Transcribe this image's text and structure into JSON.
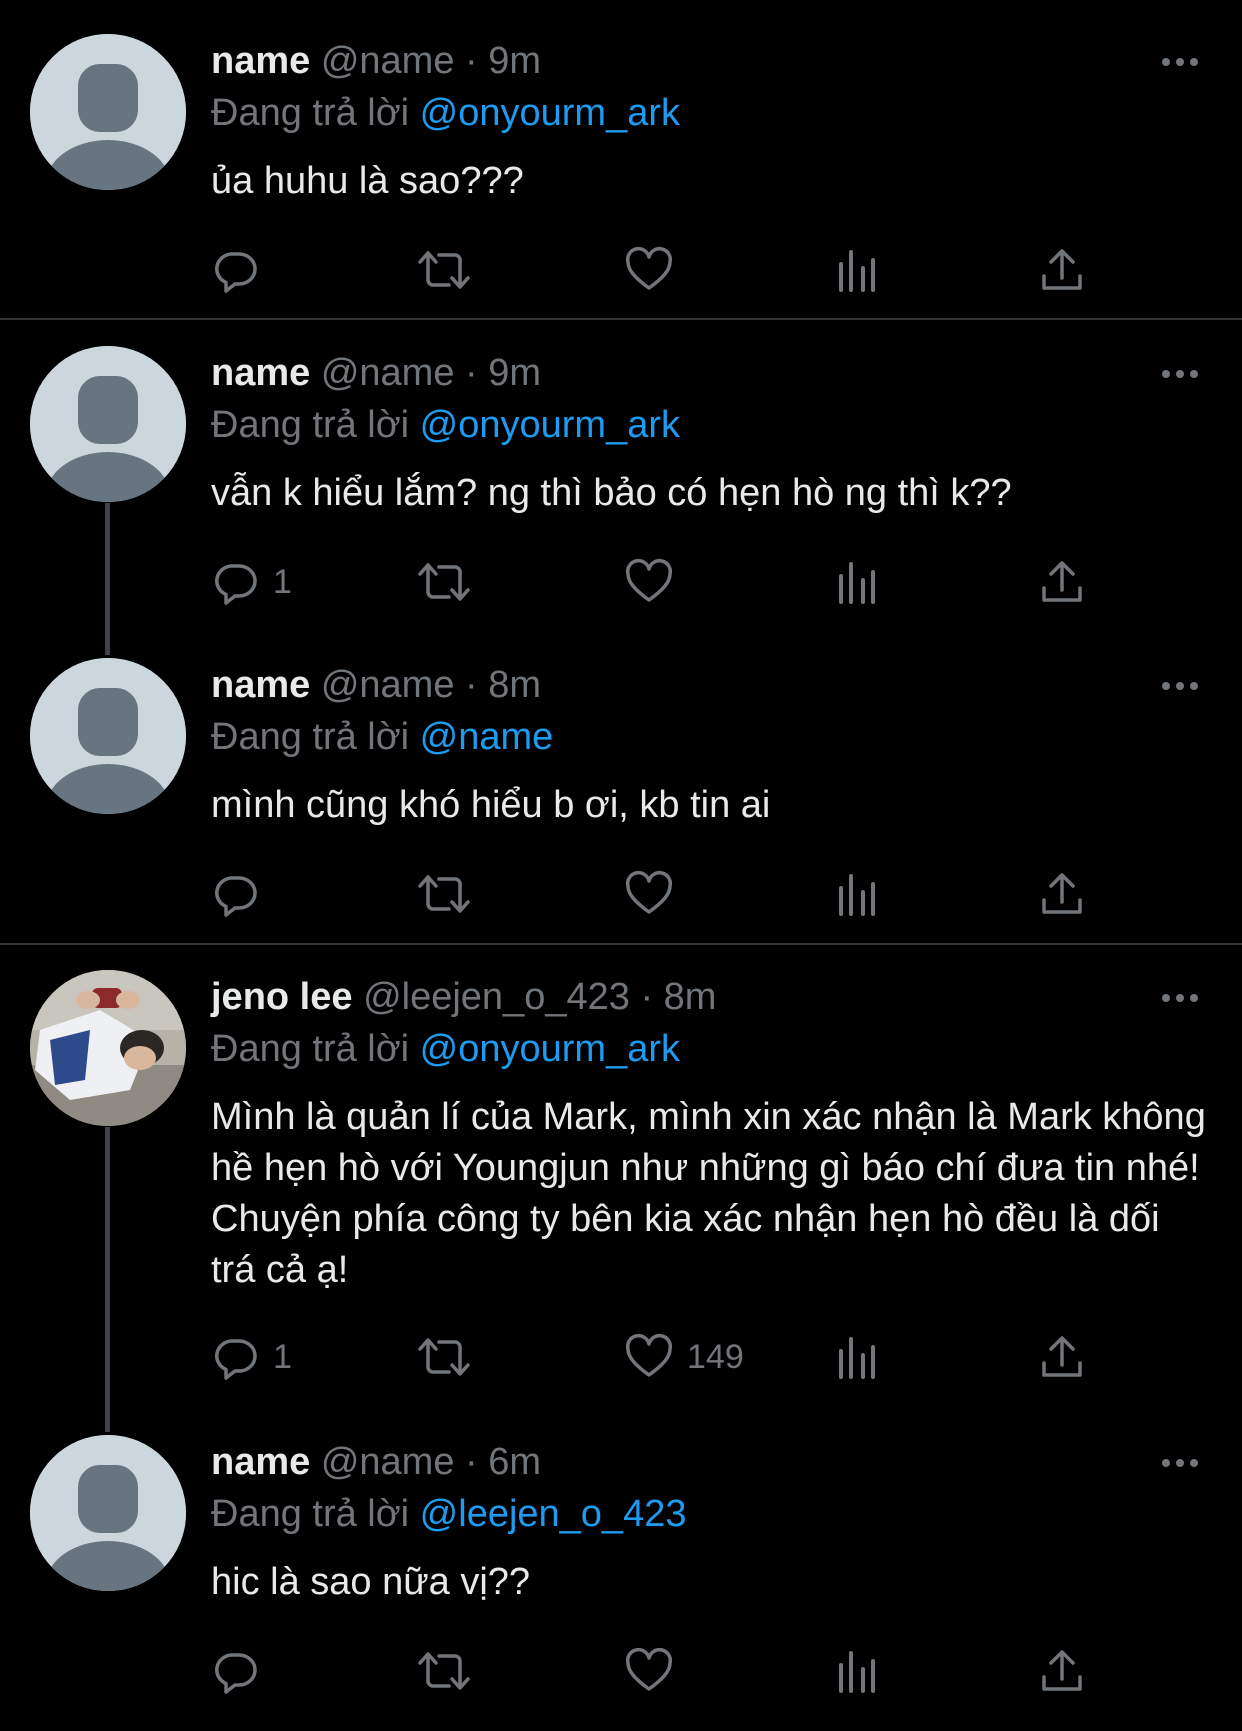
{
  "reply_prefix": "Đang trả lời",
  "colors": {
    "background": "#000000",
    "text": "#e7e9ea",
    "secondary": "#71767b",
    "accent": "#1d9bf0",
    "divider": "#2f3336"
  },
  "tweets": [
    {
      "name": "name",
      "handle": "@name",
      "dot": "·",
      "time": "9m",
      "reply_to": "@onyourm_ark",
      "text": "ủa huhu là sao???",
      "reply_count": "",
      "retweet_count": "",
      "like_count": "",
      "avatar": "default-avatar"
    },
    {
      "name": "name",
      "handle": "@name",
      "dot": "·",
      "time": "9m",
      "reply_to": "@onyourm_ark",
      "text": "vẫn k hiểu lắm? ng thì bảo có hẹn hò ng thì k??",
      "reply_count": "1",
      "retweet_count": "",
      "like_count": "",
      "avatar": "default-avatar"
    },
    {
      "name": "name",
      "handle": "@name",
      "dot": "·",
      "time": "8m",
      "reply_to": "@name",
      "text": "mình cũng khó hiểu b ơi, kb tin ai",
      "reply_count": "",
      "retweet_count": "",
      "like_count": "",
      "avatar": "default-avatar"
    },
    {
      "name": "jeno lee",
      "handle": "@leejen_o_423",
      "dot": "·",
      "time": "8m",
      "reply_to": "@onyourm_ark",
      "text": "Mình là quản lí của Mark, mình xin xác nhận là Mark không hề hẹn hò với Youngjun như những gì báo chí đưa tin nhé! Chuyện phía công ty bên kia xác nhận hẹn hò đều là dối trá cả ạ!",
      "reply_count": "1",
      "retweet_count": "",
      "like_count": "149",
      "avatar": "photo-avatar"
    },
    {
      "name": "name",
      "handle": "@name",
      "dot": "·",
      "time": "6m",
      "reply_to": "@leejen_o_423",
      "text": "hic là sao nữa vị??",
      "reply_count": "",
      "retweet_count": "",
      "like_count": "",
      "avatar": "default-avatar"
    }
  ],
  "icons": {
    "reply": "reply-icon",
    "retweet": "retweet-icon",
    "like": "heart-icon",
    "analytics": "analytics-icon",
    "share": "share-icon",
    "more": "more-icon"
  }
}
